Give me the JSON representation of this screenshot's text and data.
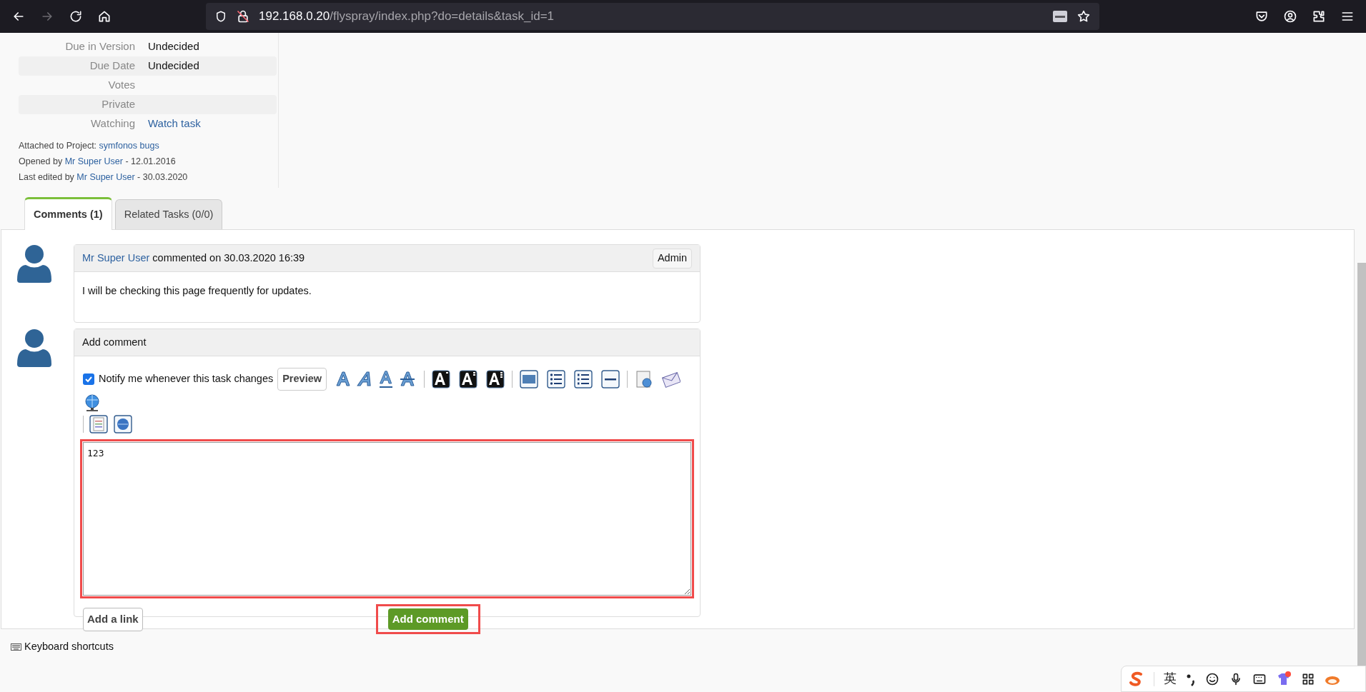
{
  "browser": {
    "url_host": "192.168.0.20",
    "url_path": "/flyspray/index.php?do=details&task_id=1"
  },
  "details": [
    {
      "label": "Due in Version",
      "value": "Undecided",
      "kind": "text"
    },
    {
      "label": "Due Date",
      "value": "Undecided",
      "kind": "text"
    },
    {
      "label": "Votes"
    },
    {
      "label": "Private"
    },
    {
      "label": "Watching",
      "value": "Watch task",
      "kind": "link"
    }
  ],
  "meta": [
    {
      "prefix": "Attached to Project:",
      "link": "symfonos bugs"
    },
    {
      "prefix": "Opened by",
      "link": "Mr Super User",
      "suffix": "- 12.01.2016"
    },
    {
      "prefix": "Last edited by",
      "link": "Mr Super User",
      "suffix": "- 30.03.2020"
    }
  ],
  "tabs": [
    {
      "label": "Comments (1)",
      "selected": true
    },
    {
      "label": "Related Tasks (0/0)",
      "selected": false
    }
  ],
  "comments": [
    {
      "author": "Mr Super User",
      "action": "commented on 30.03.2020 16:39",
      "badge": "Admin",
      "body": "I will be checking this page frequently for updates."
    }
  ],
  "add_comment": {
    "title": "Add comment",
    "notify": {
      "label": "Notify me whenever this task changes",
      "checked": true
    },
    "preview": "Preview",
    "text": "123",
    "add_link": "Add a link",
    "submit": "Add comment"
  },
  "footer": {
    "shortcuts": "Keyboard shortcuts"
  },
  "ime_bar": {
    "mode": "英"
  }
}
